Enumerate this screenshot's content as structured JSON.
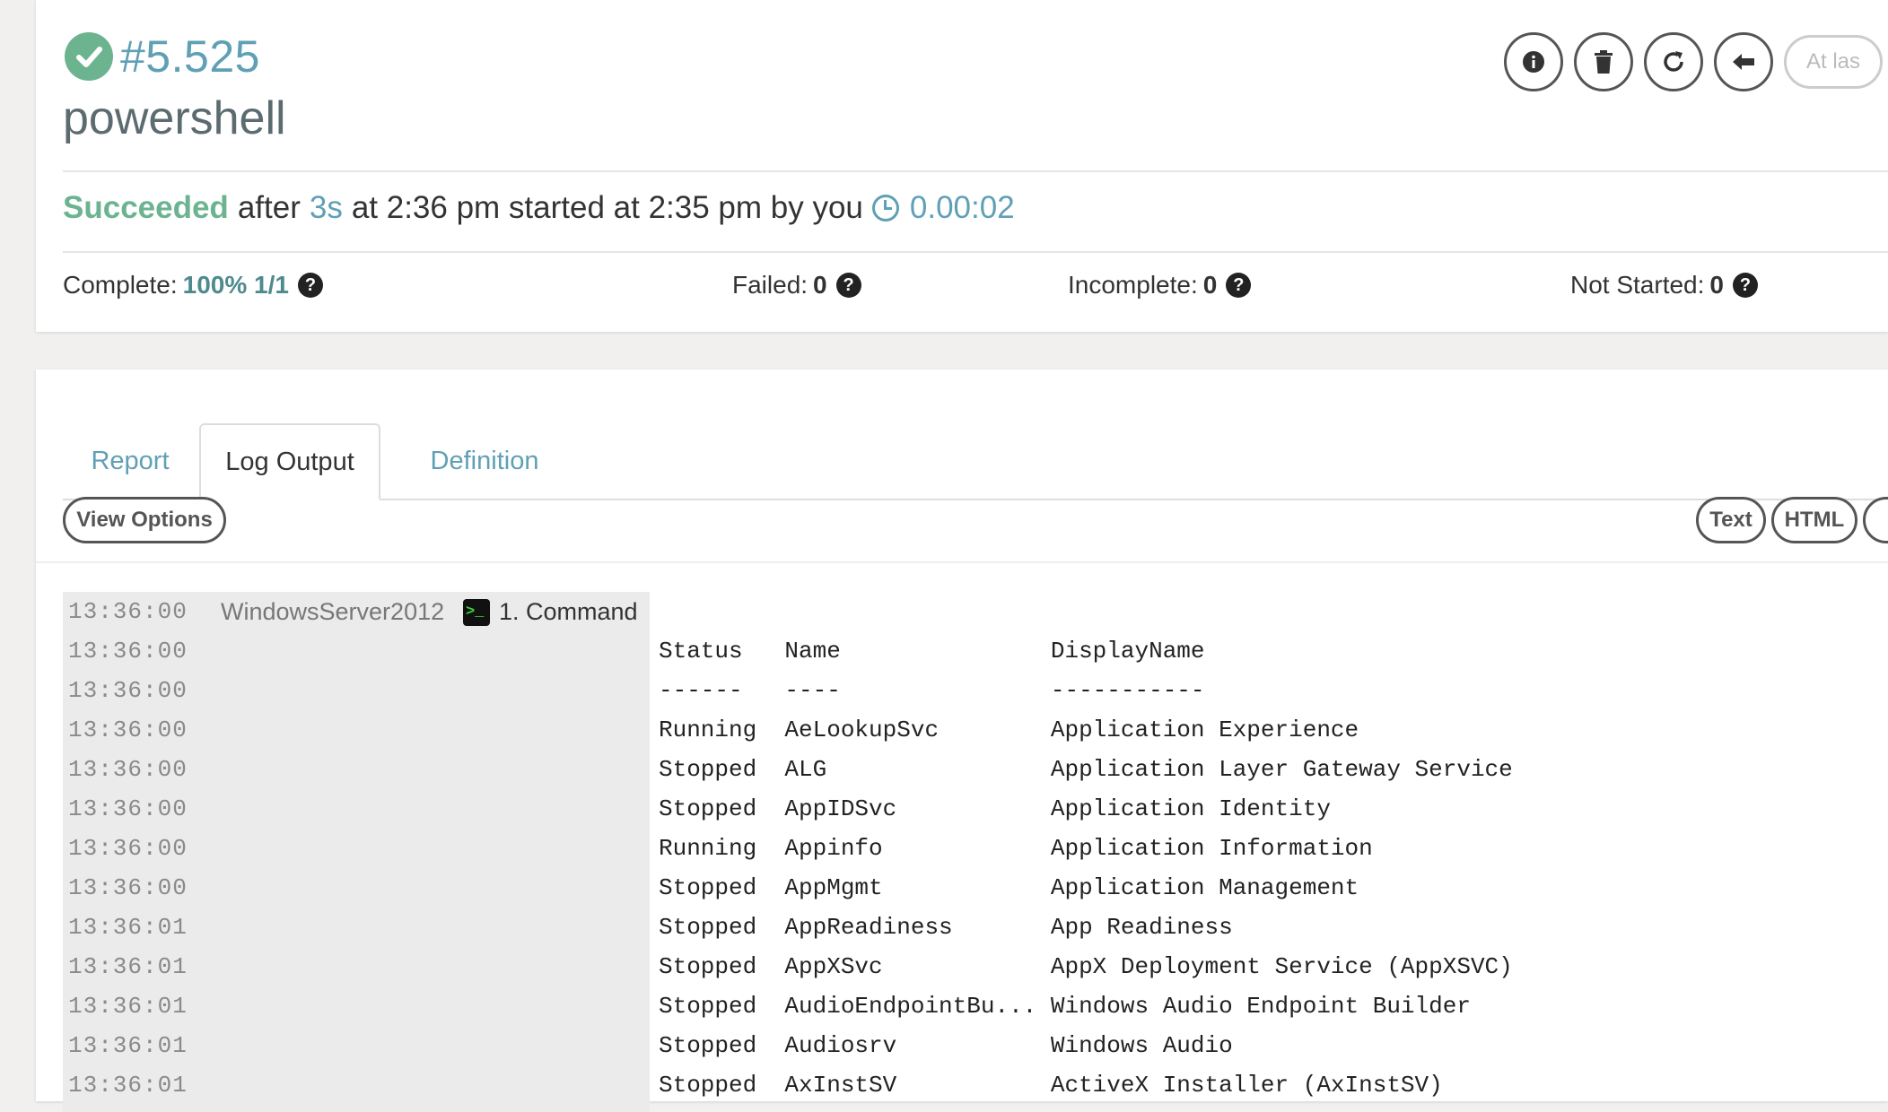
{
  "header": {
    "execution_id": "#5.525",
    "job_name": "powershell",
    "at_last_label": "At las"
  },
  "status": {
    "result": "Succeeded",
    "after_word": "after",
    "duration": "3s",
    "mid_text": "at 2:36 pm started at 2:35 pm by you",
    "elapsed": "0.00:02"
  },
  "stats": {
    "complete_label": "Complete:",
    "complete_value": "100% 1/1",
    "failed_label": "Failed:",
    "failed_value": "0",
    "incomplete_label": "Incomplete:",
    "incomplete_value": "0",
    "not_started_label": "Not Started:",
    "not_started_value": "0"
  },
  "tabs": [
    {
      "label": "Report"
    },
    {
      "label": "Log Output"
    },
    {
      "label": "Definition"
    }
  ],
  "toolbar": {
    "view_options": "View Options",
    "text": "Text",
    "html": "HTML"
  },
  "log": {
    "node": "WindowsServer2012",
    "step": "1. Command",
    "rows": [
      {
        "time": "13:36:00",
        "text": ""
      },
      {
        "time": "13:36:00",
        "text": "Status   Name               DisplayName"
      },
      {
        "time": "13:36:00",
        "text": "------   ----               -----------"
      },
      {
        "time": "13:36:00",
        "text": "Running  AeLookupSvc        Application Experience"
      },
      {
        "time": "13:36:00",
        "text": "Stopped  ALG                Application Layer Gateway Service"
      },
      {
        "time": "13:36:00",
        "text": "Stopped  AppIDSvc           Application Identity"
      },
      {
        "time": "13:36:00",
        "text": "Running  Appinfo            Application Information"
      },
      {
        "time": "13:36:00",
        "text": "Stopped  AppMgmt            Application Management"
      },
      {
        "time": "13:36:01",
        "text": "Stopped  AppReadiness       App Readiness"
      },
      {
        "time": "13:36:01",
        "text": "Stopped  AppXSvc            AppX Deployment Service (AppXSVC)"
      },
      {
        "time": "13:36:01",
        "text": "Stopped  AudioEndpointBu... Windows Audio Endpoint Builder"
      },
      {
        "time": "13:36:01",
        "text": "Stopped  Audiosrv           Windows Audio"
      },
      {
        "time": "13:36:01",
        "text": "Stopped  AxInstSV           ActiveX Installer (AxInstSV)"
      }
    ]
  }
}
